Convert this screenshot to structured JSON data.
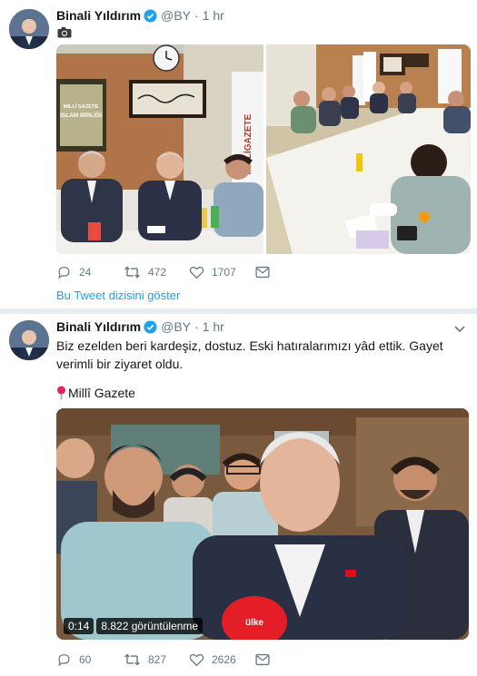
{
  "tweets": [
    {
      "author_name": "Binali Yıldırım",
      "handle": "@BY",
      "separator": "·",
      "time": "1 hr",
      "attachment_icon": "camera-icon",
      "reply_count": "24",
      "retweet_count": "472",
      "like_count": "1707",
      "show_thread": "Bu Tweet dizisini göster"
    },
    {
      "author_name": "Binali Yıldırım",
      "handle": "@BY",
      "separator": "·",
      "time": "1 hr",
      "text": "Biz ezelden beri kardeşiz, dostuz. Eski hatıralarımızı yâd ettik. Gayet verimli bir ziyaret oldu.",
      "location": "Millî Gazete",
      "video_duration": "0:14",
      "video_views": "8.822 görüntülenme",
      "reply_count": "60",
      "retweet_count": "827",
      "like_count": "2626"
    }
  ],
  "colors": {
    "accent": "#1da1f2",
    "muted": "#657786",
    "divider": "#e6ecf0"
  },
  "media_overlays": {
    "book_title": "İSLAM BİRLİĞİ",
    "book_brand": "MİLLİ GAZETE",
    "banner_text": "MİLLİGAZETE",
    "microphone_logo": "ülke"
  }
}
